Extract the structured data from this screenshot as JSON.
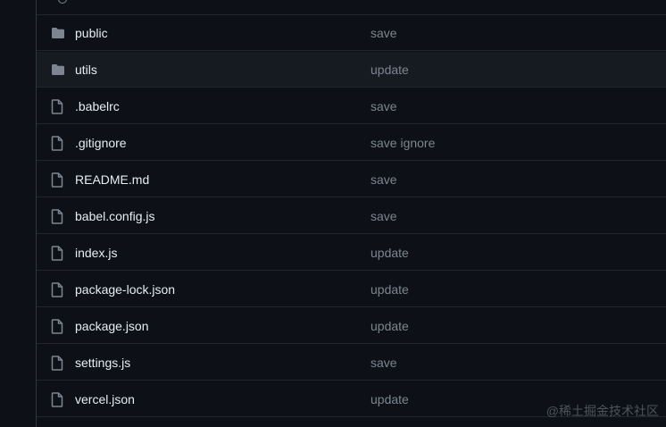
{
  "files": [
    {
      "name": "public",
      "type": "folder",
      "message": "save"
    },
    {
      "name": "utils",
      "type": "folder",
      "message": "update"
    },
    {
      "name": ".babelrc",
      "type": "file",
      "message": "save"
    },
    {
      "name": ".gitignore",
      "type": "file",
      "message": "save ignore"
    },
    {
      "name": "README.md",
      "type": "file",
      "message": "save"
    },
    {
      "name": "babel.config.js",
      "type": "file",
      "message": "save"
    },
    {
      "name": "index.js",
      "type": "file",
      "message": "update"
    },
    {
      "name": "package-lock.json",
      "type": "file",
      "message": "update"
    },
    {
      "name": "package.json",
      "type": "file",
      "message": "update"
    },
    {
      "name": "settings.js",
      "type": "file",
      "message": "save"
    },
    {
      "name": "vercel.json",
      "type": "file",
      "message": "update"
    }
  ],
  "watermark": "@稀土掘金技术社区",
  "colors": {
    "background": "#0d1117",
    "hover_row": "#161b22",
    "divider": "#21262d",
    "filename": "#e6edf3",
    "commit_message": "#7d8590",
    "icon": "#7d8590"
  },
  "icons": {
    "folder": "folder-icon",
    "file": "file-icon"
  }
}
